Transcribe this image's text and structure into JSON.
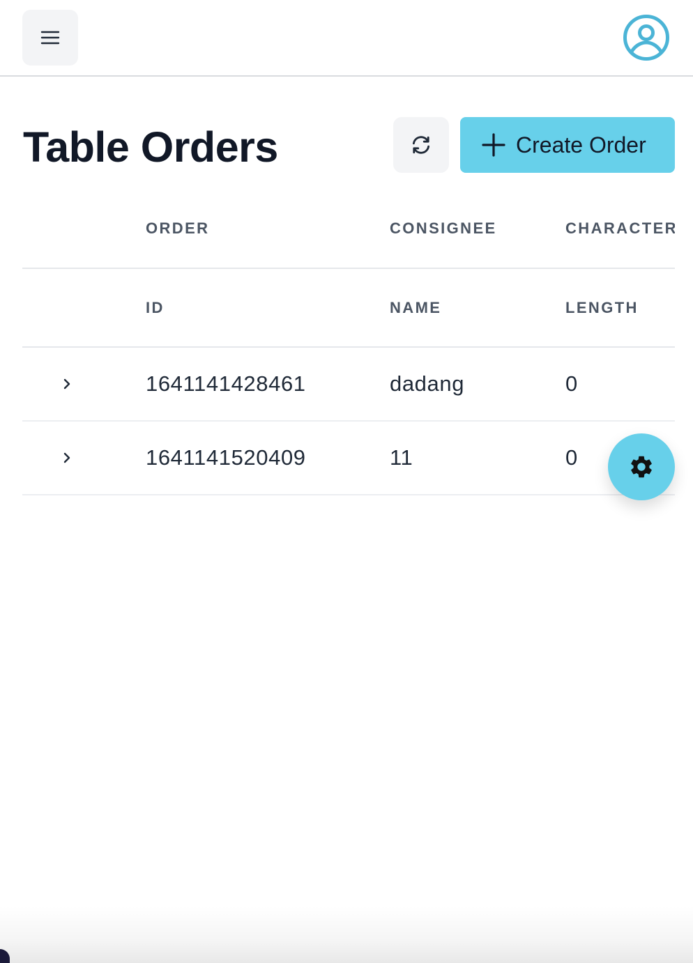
{
  "header": {
    "menu_icon": "menu-icon",
    "avatar_icon": "user-circle-icon"
  },
  "main": {
    "title": "Table Orders",
    "refresh_icon": "refresh-icon",
    "create_button": {
      "label": "Create Order",
      "icon": "plus-icon"
    }
  },
  "table": {
    "columns": [
      {
        "top": "ORDER",
        "bottom": "ID"
      },
      {
        "top": "CONSIGNEE",
        "bottom": "NAME"
      },
      {
        "top": "CHARACTER",
        "bottom": "LENGTH"
      }
    ],
    "rows": [
      {
        "order_id": "1641141428461",
        "consignee_name": "dadang",
        "character_length": "0"
      },
      {
        "order_id": "1641141520409",
        "consignee_name": "11",
        "character_length": "0"
      }
    ]
  },
  "fab": {
    "icon": "gear-icon"
  },
  "colors": {
    "accent": "#67d0ea",
    "avatar": "#4bb4d6",
    "button_gray": "#f3f4f6",
    "title": "#111827",
    "header_text": "#4b5563"
  }
}
